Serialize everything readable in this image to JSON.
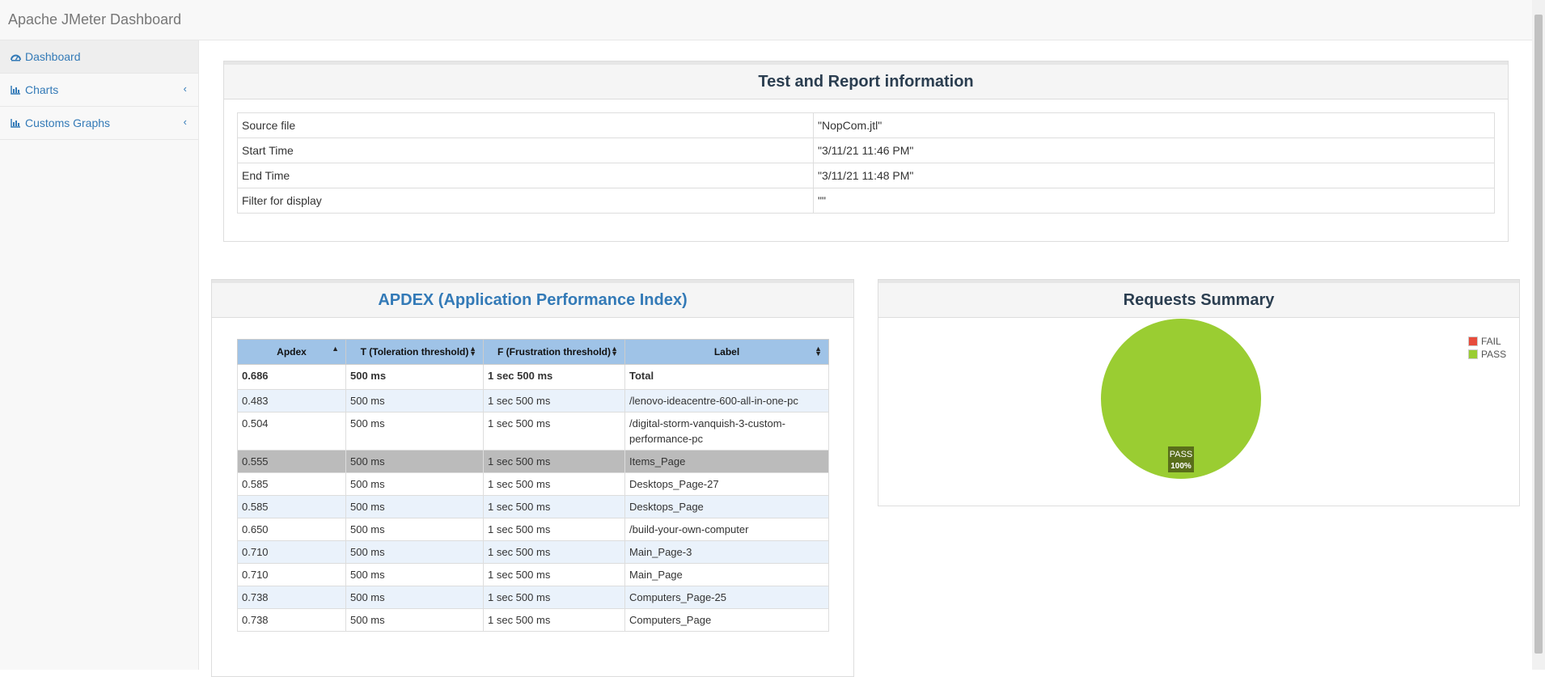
{
  "app": {
    "title": "Apache JMeter Dashboard"
  },
  "sidebar": {
    "items": [
      {
        "label": "Dashboard",
        "icon": "dashboard-icon"
      },
      {
        "label": "Charts",
        "icon": "bar-chart-icon"
      },
      {
        "label": "Customs Graphs",
        "icon": "bar-chart-icon"
      }
    ]
  },
  "info": {
    "title": "Test and Report information",
    "rows": [
      {
        "key": "Source file",
        "value": "\"NopCom.jtl\""
      },
      {
        "key": "Start Time",
        "value": "\"3/11/21 11:46 PM\""
      },
      {
        "key": "End Time",
        "value": "\"3/11/21 11:48 PM\""
      },
      {
        "key": "Filter for display",
        "value": "\"\""
      }
    ]
  },
  "apdex": {
    "title": "APDEX (Application Performance Index)",
    "headers": [
      "Apdex",
      "T (Toleration threshold)",
      "F (Frustration threshold)",
      "Label"
    ],
    "total": {
      "apdex": "0.686",
      "t": "500 ms",
      "f": "1 sec 500 ms",
      "label": "Total"
    },
    "rows": [
      {
        "apdex": "0.483",
        "t": "500 ms",
        "f": "1 sec 500 ms",
        "label": "/lenovo-ideacentre-600-all-in-one-pc"
      },
      {
        "apdex": "0.504",
        "t": "500 ms",
        "f": "1 sec 500 ms",
        "label": "/digital-storm-vanquish-3-custom-performance-pc"
      },
      {
        "apdex": "0.555",
        "t": "500 ms",
        "f": "1 sec 500 ms",
        "label": "Items_Page"
      },
      {
        "apdex": "0.585",
        "t": "500 ms",
        "f": "1 sec 500 ms",
        "label": "Desktops_Page-27"
      },
      {
        "apdex": "0.585",
        "t": "500 ms",
        "f": "1 sec 500 ms",
        "label": "Desktops_Page"
      },
      {
        "apdex": "0.650",
        "t": "500 ms",
        "f": "1 sec 500 ms",
        "label": "/build-your-own-computer"
      },
      {
        "apdex": "0.710",
        "t": "500 ms",
        "f": "1 sec 500 ms",
        "label": "Main_Page-3"
      },
      {
        "apdex": "0.710",
        "t": "500 ms",
        "f": "1 sec 500 ms",
        "label": "Main_Page"
      },
      {
        "apdex": "0.738",
        "t": "500 ms",
        "f": "1 sec 500 ms",
        "label": "Computers_Page-25"
      },
      {
        "apdex": "0.738",
        "t": "500 ms",
        "f": "1 sec 500 ms",
        "label": "Computers_Page"
      }
    ]
  },
  "requests": {
    "title": "Requests Summary",
    "legend": [
      {
        "label": "FAIL",
        "color": "#e74c3c"
      },
      {
        "label": "PASS",
        "color": "#9acd32"
      }
    ],
    "slice_label": "PASS",
    "slice_pct": "100%"
  },
  "chart_data": {
    "type": "pie",
    "title": "Requests Summary",
    "categories": [
      "FAIL",
      "PASS"
    ],
    "values": [
      0,
      100
    ],
    "colors": [
      "#e74c3c",
      "#9acd32"
    ],
    "legend": "top-right"
  },
  "colors": {
    "link": "#337ab7",
    "table_header": "#9fc3e7",
    "pass": "#9acd32",
    "fail": "#e74c3c"
  }
}
